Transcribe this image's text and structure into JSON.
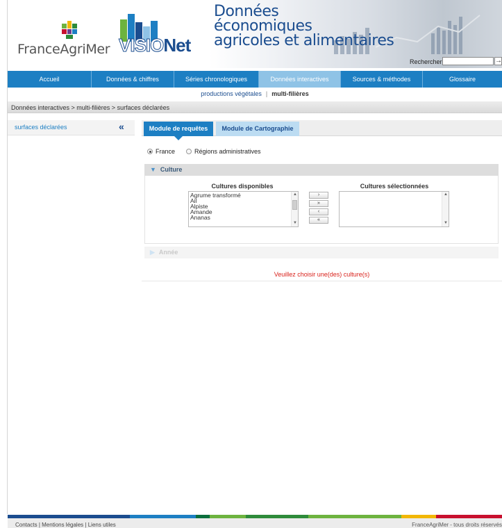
{
  "header": {
    "logo_franceagrimer": "FranceAgriMer",
    "logo_visionet_part1": "VISIO",
    "logo_visionet_part2": "Net",
    "title_line1": "Données",
    "title_line2": "économiques",
    "title_line3": "agricoles et alimentaires",
    "search_label": "Rechercher",
    "search_value": "",
    "search_go_icon": "→"
  },
  "nav": {
    "items": [
      {
        "label": "Accueil"
      },
      {
        "label": "Données & chiffres"
      },
      {
        "label": "Séries chronologiques"
      },
      {
        "label": "Données interactives"
      },
      {
        "label": "Sources & méthodes"
      },
      {
        "label": "Glossaire"
      }
    ],
    "active_index": 3
  },
  "subnav": {
    "item1": "productions végétales",
    "separator": "|",
    "item2": "multi-filières"
  },
  "breadcrumb": "Données interactives > multi-filières > surfaces déclarées",
  "sidebar": {
    "item": "surfaces déclarées",
    "collapse_icon": "«"
  },
  "tabs": {
    "requetes": "Module de requêtes",
    "cartographie": "Module de Cartographie"
  },
  "scope": {
    "france": "France",
    "regions": "Régions administratives",
    "selected": "France"
  },
  "culture": {
    "heading": "Culture",
    "available_title": "Cultures disponibles",
    "selected_title": "Cultures sélectionnées",
    "available": [
      "Agrume transformé",
      "Ail",
      "Alpiste",
      "Amande",
      "Ananas"
    ],
    "selected": [],
    "buttons": {
      "add": "›",
      "add_all": "»",
      "remove": "‹",
      "remove_all": "«"
    }
  },
  "annee": {
    "heading": "Année"
  },
  "warning": "Veuillez choisir une(des) culture(s)",
  "footer": {
    "contacts": "Contacts",
    "mentions": "Mentions légales",
    "liens": "Liens utiles",
    "separator": "|",
    "copyright": "FranceAgriMer - tous droits réservés"
  },
  "colors": {
    "nav_blue": "#1d7fc3",
    "nav_active": "#8fc3e6",
    "title_blue": "#1b4d8f",
    "warning_red": "#d9231d",
    "footer_stripe": [
      "#1b4d8f",
      "#1d7fc3",
      "#0b6e3c",
      "#6db33f",
      "#2e8b3a",
      "#6db33f",
      "#f2b705",
      "#c8102e"
    ]
  }
}
